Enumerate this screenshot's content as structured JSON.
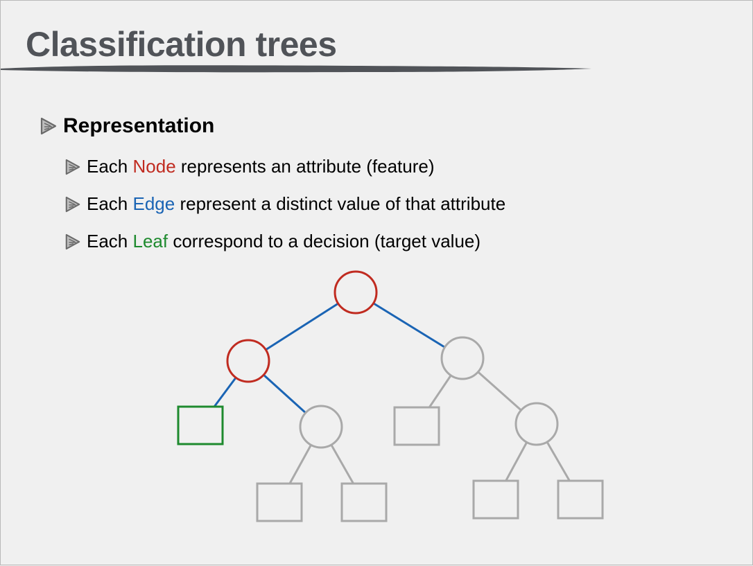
{
  "slide": {
    "title": "Classification trees",
    "heading": "Representation",
    "bullets": [
      {
        "prefix": "Each ",
        "keyword": "Node",
        "suffix": " represents an attribute (feature)",
        "keyword_color": "#c02b20"
      },
      {
        "prefix": "Each ",
        "keyword": "Edge",
        "suffix": " represent a distinct value of that attribute",
        "keyword_color": "#1a64b4"
      },
      {
        "prefix": "Each ",
        "keyword": "Leaf",
        "suffix": " correspond to a decision (target value)",
        "keyword_color": "#1e8a2e"
      }
    ]
  },
  "diagram": {
    "colors": {
      "highlight_node": "#c02b20",
      "highlight_edge": "#1a64b4",
      "highlight_leaf": "#1e8a2e",
      "default": "#a9a9a9"
    },
    "nodes": [
      {
        "id": "root",
        "kind": "node",
        "highlighted": true
      },
      {
        "id": "n-left",
        "kind": "node",
        "highlighted": true
      },
      {
        "id": "n-right",
        "kind": "node",
        "highlighted": false
      },
      {
        "id": "n-left-right",
        "kind": "node",
        "highlighted": false
      },
      {
        "id": "n-right-right",
        "kind": "node",
        "highlighted": false
      },
      {
        "id": "leaf-left-left",
        "kind": "leaf",
        "highlighted": true
      },
      {
        "id": "leaf-right-left",
        "kind": "leaf",
        "highlighted": false
      },
      {
        "id": "leaf-lr-left",
        "kind": "leaf",
        "highlighted": false
      },
      {
        "id": "leaf-lr-right",
        "kind": "leaf",
        "highlighted": false
      },
      {
        "id": "leaf-rr-left",
        "kind": "leaf",
        "highlighted": false
      },
      {
        "id": "leaf-rr-right",
        "kind": "leaf",
        "highlighted": false
      }
    ],
    "edges": [
      {
        "from": "root",
        "to": "n-left",
        "highlighted": true
      },
      {
        "from": "root",
        "to": "n-right",
        "highlighted": true
      },
      {
        "from": "n-left",
        "to": "leaf-left-left",
        "highlighted": true
      },
      {
        "from": "n-left",
        "to": "n-left-right",
        "highlighted": true
      },
      {
        "from": "n-right",
        "to": "leaf-right-left",
        "highlighted": false
      },
      {
        "from": "n-right",
        "to": "n-right-right",
        "highlighted": false
      },
      {
        "from": "n-left-right",
        "to": "leaf-lr-left",
        "highlighted": false
      },
      {
        "from": "n-left-right",
        "to": "leaf-lr-right",
        "highlighted": false
      },
      {
        "from": "n-right-right",
        "to": "leaf-rr-left",
        "highlighted": false
      },
      {
        "from": "n-right-right",
        "to": "leaf-rr-right",
        "highlighted": false
      }
    ]
  }
}
